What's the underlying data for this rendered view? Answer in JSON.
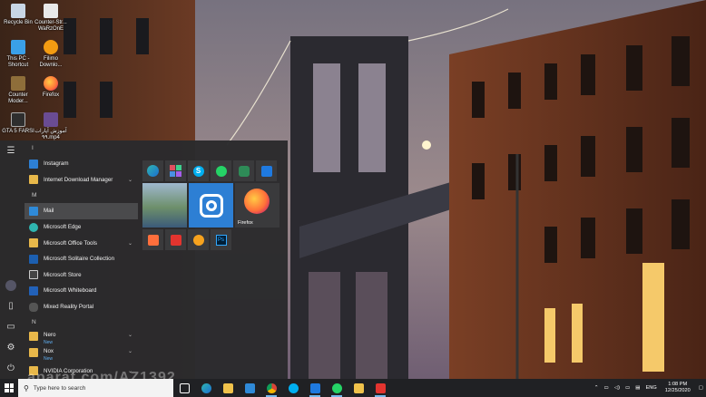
{
  "desktop": {
    "icons": [
      {
        "label": "Recycle Bin",
        "icon": "recycle-bin-icon",
        "color": "#c8d6e5"
      },
      {
        "label": "Counter-Str... WaRzOnE",
        "icon": "counter-strike-icon",
        "color": "#e9e9e9"
      },
      {
        "label": "This PC - Shortcut",
        "icon": "this-pc-icon",
        "color": "#3aa0e8"
      },
      {
        "label": "Filimo Downlo...",
        "icon": "filimo-icon",
        "color": "#f39c12"
      },
      {
        "label": "Counter Moder...",
        "icon": "counter-modern-icon",
        "color": "#8e6e3a"
      },
      {
        "label": "Firefox",
        "icon": "firefox-icon",
        "color": "#ff7139"
      },
      {
        "label": "GTA 5 FARSI",
        "icon": "gta-icon",
        "color": "#2e2e2e"
      },
      {
        "label": "آموزش آپارات ۹۹.mp4",
        "icon": "video-file-icon",
        "color": "#6a4c93"
      }
    ]
  },
  "start_menu": {
    "rail": [
      "hamburger-menu-icon",
      "user-avatar-icon",
      "documents-icon",
      "pictures-icon",
      "settings-icon",
      "power-icon"
    ],
    "sections": [
      {
        "letter": "I",
        "apps": [
          {
            "label": "Instagram",
            "icon": "instagram-icon",
            "color": "#2d7fd4"
          },
          {
            "label": "Internet Download Manager",
            "icon": "folder-icon",
            "color": "#e8b84a",
            "expand": "⌄"
          }
        ]
      },
      {
        "letter": "M",
        "apps": [
          {
            "label": "Mail",
            "icon": "mail-icon",
            "color": "#2f8ad8",
            "hover": true
          },
          {
            "label": "Microsoft Edge",
            "icon": "edge-icon",
            "color": "#2fb5b0"
          },
          {
            "label": "Microsoft Office Tools",
            "icon": "folder-icon",
            "color": "#e8b84a",
            "expand": "⌄"
          },
          {
            "label": "Microsoft Solitaire Collection",
            "icon": "solitaire-icon",
            "color": "#1c5fb0"
          },
          {
            "label": "Microsoft Store",
            "icon": "store-icon",
            "color": "#444"
          },
          {
            "label": "Microsoft Whiteboard",
            "icon": "whiteboard-icon",
            "color": "#2261b8"
          },
          {
            "label": "Mixed Reality Portal",
            "icon": "mixed-reality-icon",
            "color": "#555"
          }
        ]
      },
      {
        "letter": "N",
        "apps": [
          {
            "label": "Nero",
            "sub": "New",
            "icon": "folder-icon",
            "color": "#e8b84a",
            "expand": "⌄"
          },
          {
            "label": "Nox",
            "sub": "New",
            "icon": "folder-icon",
            "color": "#e8b84a",
            "expand": "⌄"
          },
          {
            "label": "NVIDIA Corporation",
            "icon": "folder-icon",
            "color": "#e8b84a",
            "expand": "⌄"
          }
        ]
      }
    ],
    "tiles": {
      "firefox_label": "Firefox"
    }
  },
  "taskbar": {
    "search_placeholder": "Type here to search",
    "language": "ENG",
    "time": "1:08 PM",
    "date": "12/25/2020"
  },
  "watermark": "aparat.com/AZ1392"
}
